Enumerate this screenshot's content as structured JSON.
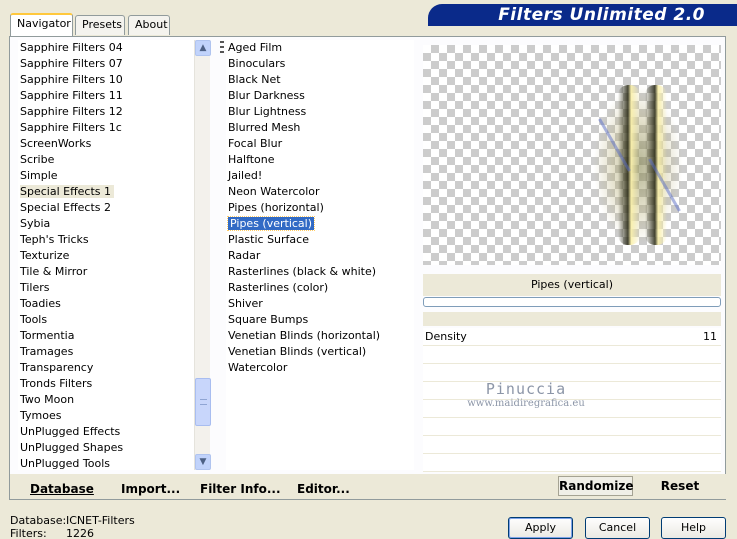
{
  "header": {
    "title": "Filters Unlimited 2.0"
  },
  "tabs": [
    {
      "label": "Navigator",
      "active": true
    },
    {
      "label": "Presets",
      "active": false
    },
    {
      "label": "About",
      "active": false
    }
  ],
  "categories": {
    "selected": "Special Effects 1",
    "items": [
      "Sapphire Filters 04",
      "Sapphire Filters 07",
      "Sapphire Filters 10",
      "Sapphire Filters 11",
      "Sapphire Filters 12",
      "Sapphire Filters 1c",
      "ScreenWorks",
      "Scribe",
      "Simple",
      "Special Effects 1",
      "Special Effects 2",
      "Sybia",
      "Teph's Tricks",
      "Texturize",
      "Tile & Mirror",
      "Tilers",
      "Toadies",
      "Tools",
      "Tormentia",
      "Tramages",
      "Transparency",
      "Tronds Filters",
      "Two Moon",
      "Tymoes",
      "UnPlugged Effects",
      "UnPlugged Shapes",
      "UnPlugged Tools"
    ]
  },
  "effects": {
    "selected": "Pipes (vertical)",
    "items": [
      "Aged Film",
      "Binoculars",
      "Black Net",
      "Blur Darkness",
      "Blur Lightness",
      "Blurred Mesh",
      "Focal Blur",
      "Halftone",
      "Jailed!",
      "Neon Watercolor",
      "Pipes (horizontal)",
      "Pipes (vertical)",
      "Plastic Surface",
      "Radar",
      "Rasterlines (black & white)",
      "Rasterlines (color)",
      "Shiver",
      "Square Bumps",
      "Venetian Blinds (horizontal)",
      "Venetian Blinds (vertical)",
      "Watercolor"
    ]
  },
  "preview": {
    "effect_name": "Pipes (vertical)",
    "progress": 0
  },
  "parameters": [
    {
      "name": "Density",
      "value": "11"
    }
  ],
  "watermark": {
    "line1": "Pinuccia",
    "line2": "www.maidiregrafica.eu"
  },
  "toolbar": {
    "database": "Database",
    "import": "Import...",
    "filter_info": "Filter Info...",
    "editor": "Editor...",
    "randomize": "Randomize",
    "reset": "Reset"
  },
  "footer": {
    "database_label": "Database:",
    "database_value": "ICNET-Filters",
    "filters_label": "Filters:",
    "filters_value": "1226",
    "apply": "Apply",
    "cancel": "Cancel",
    "help": "Help"
  },
  "colors": {
    "banner": "#0a2a8a",
    "selection": "#316ac5",
    "background": "#ece9d8"
  }
}
